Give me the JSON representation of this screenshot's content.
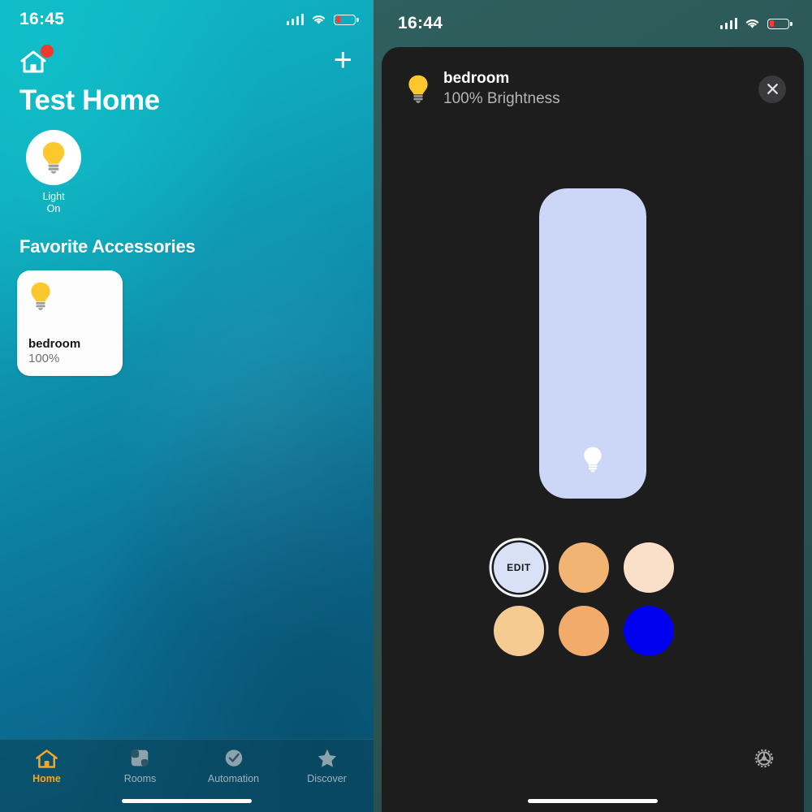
{
  "left_phone": {
    "status_bar": {
      "time": "16:45",
      "signal_icon": "cellular-signal-icon",
      "wifi_icon": "wifi-icon",
      "battery_icon": "battery-low-icon"
    },
    "nav": {
      "home_icon": "house-icon",
      "badge": "notification-dot",
      "add_label": "+"
    },
    "home_title": "Test Home",
    "status_items": [
      {
        "icon": "lightbulb-icon",
        "line1": "Light",
        "line2": "On"
      }
    ],
    "section_title": "Favorite Accessories",
    "accessories": [
      {
        "icon": "lightbulb-icon",
        "name": "bedroom",
        "value": "100%"
      }
    ],
    "tabs": [
      {
        "label": "Home",
        "icon": "house-icon",
        "active": true
      },
      {
        "label": "Rooms",
        "icon": "rooms-icon",
        "active": false
      },
      {
        "label": "Automation",
        "icon": "clock-check-icon",
        "active": false
      },
      {
        "label": "Discover",
        "icon": "star-icon",
        "active": false
      }
    ]
  },
  "right_phone": {
    "status_bar": {
      "time": "16:44",
      "signal_icon": "cellular-signal-icon",
      "wifi_icon": "wifi-icon",
      "battery_icon": "battery-low-icon"
    },
    "sheet": {
      "accessory_icon": "lightbulb-icon",
      "title": "bedroom",
      "subtitle": "100% Brightness",
      "close_icon": "close-icon",
      "brightness_percent": 100,
      "slider_icon": "lightbulb-icon",
      "swatches": [
        {
          "name": "edit-swatch",
          "label": "EDIT",
          "color": "#d9e1f7"
        },
        {
          "name": "color-swatch-orange",
          "label": "",
          "color": "#f2b473"
        },
        {
          "name": "color-swatch-cream",
          "label": "",
          "color": "#fae0c8"
        },
        {
          "name": "color-swatch-peach",
          "label": "",
          "color": "#f5cb92"
        },
        {
          "name": "color-swatch-amber",
          "label": "",
          "color": "#f2ab6a"
        },
        {
          "name": "color-swatch-blue",
          "label": "",
          "color": "#0000ee"
        }
      ],
      "settings_icon": "gear-icon"
    }
  },
  "colors": {
    "accent_orange": "#f5a623",
    "bulb_yellow": "#fdc72e",
    "slider_fill": "#ccd7f7",
    "sheet_bg": "#1d1d1d",
    "battery_red": "#ff3b30"
  }
}
